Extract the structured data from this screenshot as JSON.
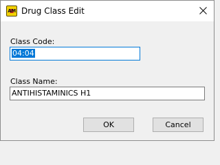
{
  "window": {
    "title": "Drug Class Edit",
    "icon": "app-logo-icon",
    "icon_text": "AM"
  },
  "form": {
    "class_code_label": "Class Code:",
    "class_code_value": "04:04",
    "class_name_label": "Class Name:",
    "class_name_value": "ANTIHISTAMINICS H1"
  },
  "buttons": {
    "ok_label": "OK",
    "cancel_label": "Cancel"
  },
  "colors": {
    "selection": "#0078d7",
    "background": "#f0f0f0",
    "titlebar": "#ffffff"
  }
}
